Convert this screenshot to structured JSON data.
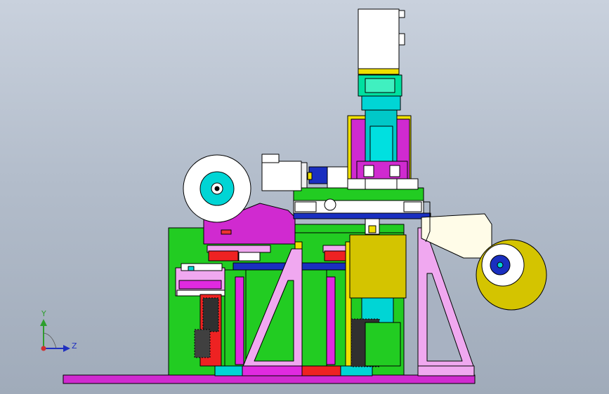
{
  "viewport": {
    "background_top": "#c9d1dd",
    "background_bottom": "#a0abba"
  },
  "triad": {
    "y_label": "Y",
    "z_label": "Z",
    "y_color": "#2e9e2e",
    "z_color": "#2030c0",
    "origin_color": "#d03030"
  }
}
